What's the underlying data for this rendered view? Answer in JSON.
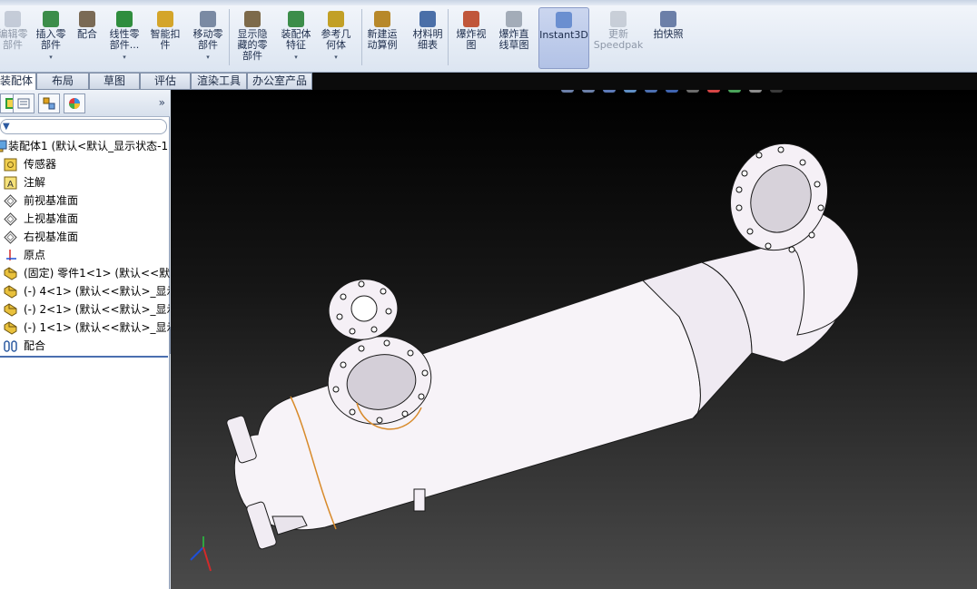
{
  "ribbon": {
    "buttons": [
      {
        "id": "edit-component",
        "label": "编辑零\n部件",
        "disabled": true,
        "arrow": false
      },
      {
        "id": "insert-component",
        "label": "插入零\n部件",
        "disabled": false,
        "arrow": true
      },
      {
        "id": "mate",
        "label": "配合",
        "disabled": false,
        "arrow": false
      },
      {
        "id": "linear-pattern",
        "label": "线性零\n部件...",
        "disabled": false,
        "arrow": true
      },
      {
        "id": "smart-fasteners",
        "label": "智能扣\n件",
        "disabled": false,
        "arrow": false
      },
      {
        "id": "move-component",
        "label": "移动零\n部件",
        "disabled": false,
        "arrow": true
      },
      {
        "id": "show-hidden",
        "label": "显示隐\n藏的零\n部件",
        "disabled": false,
        "arrow": false
      },
      {
        "id": "assembly-features",
        "label": "装配体\n特征",
        "disabled": false,
        "arrow": true
      },
      {
        "id": "reference-geometry",
        "label": "参考几\n何体",
        "disabled": false,
        "arrow": true
      },
      {
        "id": "new-motion-study",
        "label": "新建运\n动算例",
        "disabled": false,
        "arrow": false
      },
      {
        "id": "bill-of-materials",
        "label": "材料明\n细表",
        "disabled": false,
        "arrow": false
      },
      {
        "id": "exploded-view",
        "label": "爆炸视\n图",
        "disabled": false,
        "arrow": false
      },
      {
        "id": "explode-line-sketch",
        "label": "爆炸直\n线草图",
        "disabled": false,
        "arrow": false
      },
      {
        "id": "instant3d",
        "label": "Instant3D",
        "disabled": false,
        "arrow": false,
        "active": true
      },
      {
        "id": "update-speedpak",
        "label": "更新\nSpeedpak",
        "disabled": true,
        "arrow": false
      },
      {
        "id": "take-snapshot",
        "label": "拍快照",
        "disabled": false,
        "arrow": false
      }
    ]
  },
  "tabs": [
    {
      "label": "装配体",
      "active": true
    },
    {
      "label": "布局",
      "active": false
    },
    {
      "label": "草图",
      "active": false
    },
    {
      "label": "评估",
      "active": false
    },
    {
      "label": "渲染工具",
      "active": false
    },
    {
      "label": "办公室产品",
      "active": false
    }
  ],
  "tree": {
    "items": [
      {
        "label": "装配体1  (默认<默认_显示状态-1",
        "icon": "assembly-icon"
      },
      {
        "label": "传感器",
        "icon": "sensor-icon"
      },
      {
        "label": "注解",
        "icon": "annotation-icon"
      },
      {
        "label": "前视基准面",
        "icon": "plane-icon"
      },
      {
        "label": "上视基准面",
        "icon": "plane-icon"
      },
      {
        "label": "右视基准面",
        "icon": "plane-icon"
      },
      {
        "label": "原点",
        "icon": "origin-icon"
      },
      {
        "label": "(固定) 零件1<1> (默认<<默认",
        "icon": "part-icon"
      },
      {
        "label": "(-) 4<1> (默认<<默认>_显示",
        "icon": "part-icon"
      },
      {
        "label": "(-) 2<1> (默认<<默认>_显示",
        "icon": "part-icon"
      },
      {
        "label": "(-) 1<1> (默认<<默认>_显示",
        "icon": "part-icon"
      },
      {
        "label": "配合",
        "icon": "mates-icon"
      }
    ]
  },
  "panel": {
    "more_symbol": "»",
    "filter_symbol": "▼"
  }
}
